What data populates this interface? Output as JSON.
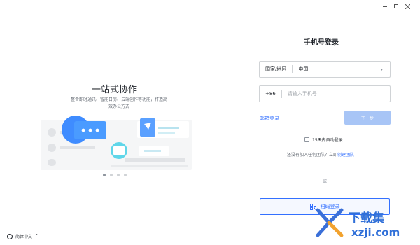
{
  "window": {
    "icons": [
      "minimize-icon",
      "maximize-icon",
      "close-icon"
    ]
  },
  "promo": {
    "title": "一站式协作",
    "subtitle": "整合即时通讯、智能日历、云端创作等功能，打造高效办公方式",
    "carousel_count": 4,
    "carousel_active": 1
  },
  "language": {
    "label": "简体中文",
    "chevron": "^"
  },
  "login": {
    "title": "手机号登录",
    "country_label": "国家/地区",
    "country_value": "中国",
    "phone_prefix": "+86",
    "phone_placeholder": "请输入手机号",
    "email_login": "邮箱登录",
    "next_button": "下一步",
    "auto_login": "15天内自动登录",
    "no_team_text": "还没有加入任何团队？立即",
    "create_team": "创建团队",
    "or": "或",
    "qr_button": "扫码登录"
  },
  "watermark": {
    "text_cn": "下载集",
    "text_en": "xzji.com"
  },
  "colors": {
    "accent": "#3370ff",
    "next_disabled": "#a8c5f6",
    "border": "#d0d3d6"
  }
}
